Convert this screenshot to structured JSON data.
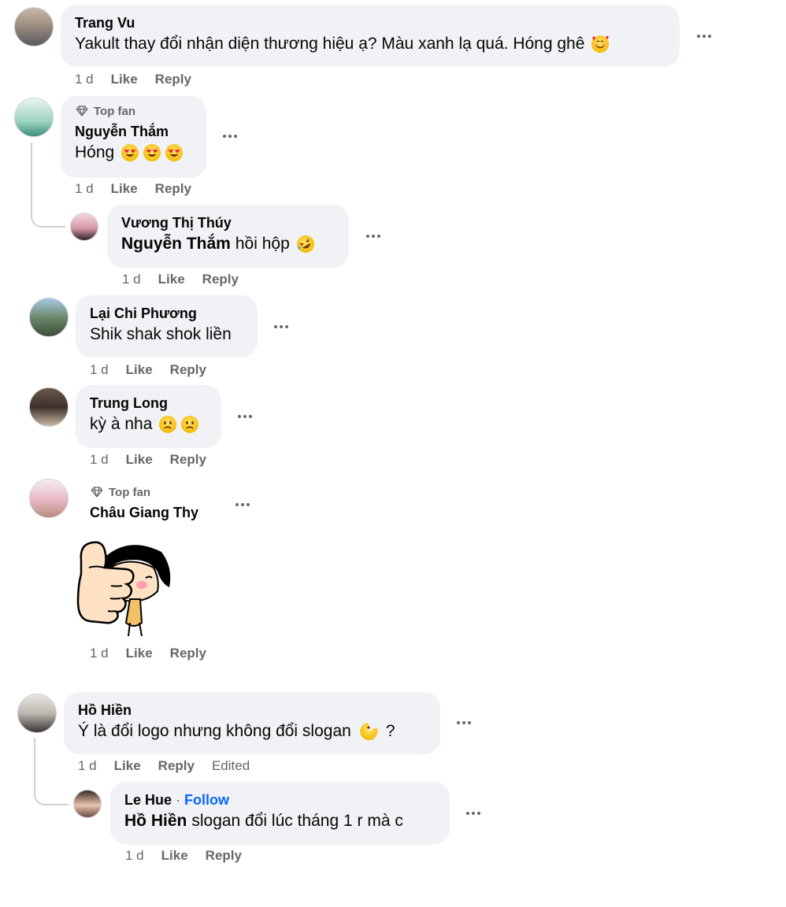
{
  "labels": {
    "like": "Like",
    "reply": "Reply",
    "top_fan": "Top fan",
    "edited": "Edited",
    "dot": " · ",
    "follow": "Follow"
  },
  "comments": [
    {
      "author": "Trang Vu",
      "text": "Yakult thay đổi nhận diện thương hiệu ạ? Màu xanh lạ quá. Hóng ghê",
      "time": "1 d",
      "emoji": "smiling-hearts-emoji"
    },
    {
      "author": "Nguyễn Thắm",
      "top_fan": true,
      "text": "Hóng",
      "time": "1 d",
      "emoji": "heart-eyes-emoji x3"
    },
    {
      "author": "Vương Thị Thúy",
      "mention": "Nguyễn Thắm",
      "text": "hồi hộp",
      "time": "1 d",
      "emoji": "rofl-emoji",
      "reply": true
    },
    {
      "author": "Lại Chi Phương",
      "text": "Shik shak shok liền",
      "time": "1 d"
    },
    {
      "author": "Trung Long",
      "text": "kỳ à nha",
      "time": "1 d",
      "emoji": "frowning-emoji x2"
    },
    {
      "author": "Châu Giang Thy",
      "top_fan": true,
      "time": "1 d",
      "sticker": "thumbs-up-girl-sticker"
    },
    {
      "author": "Hồ Hiền",
      "text": "Ý là đổi logo nhưng không đổi slogan",
      "text_suffix": "?",
      "time": "1 d",
      "edited": true,
      "emoji": "pacman-emoji"
    },
    {
      "author": "Le Hue",
      "follow": true,
      "mention": "Hồ Hiền",
      "text": "slogan đổi lúc tháng 1 r mà c",
      "time": "1 d",
      "reply": true
    }
  ],
  "colors": {
    "bubble": "#f0f2f5",
    "meta": "#65676b",
    "follow": "#0866ff",
    "thread": "#ced0d4"
  }
}
